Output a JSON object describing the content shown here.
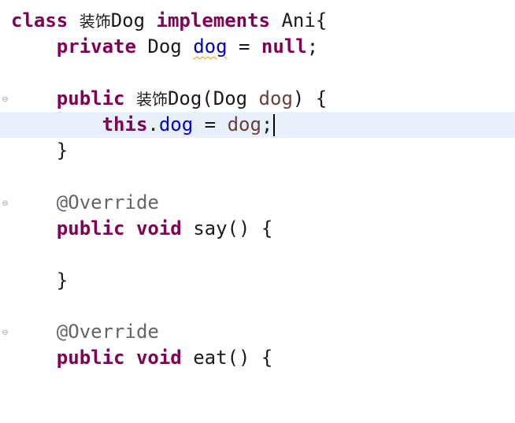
{
  "editor": {
    "fold_icon_glyph": "⊖",
    "lines": {
      "l1": {
        "kw_class": "class",
        "sp1": " ",
        "cjk_name": "装饰",
        "class_name": "Dog",
        "sp2": " ",
        "kw_implements": "implements",
        "rest": " Ani{"
      },
      "l2": {
        "indent": "    ",
        "kw_private": "private",
        "mid": " Dog ",
        "field_dog": "dog",
        "eq": " = ",
        "kw_null": "null",
        "semi": ";"
      },
      "l4": {
        "indent": "    ",
        "kw_public": "public",
        "sp": " ",
        "cjk_name": "装饰",
        "ctor_rest": "Dog(Dog ",
        "param_dog": "dog",
        "tail": ") {"
      },
      "l5": {
        "indent": "        ",
        "kw_this": "this",
        "dot": ".",
        "field_dog": "dog",
        "eq": " = ",
        "param_dog": "dog",
        "semi": ";"
      },
      "l6": {
        "indent": "    ",
        "brace": "}"
      },
      "l8": {
        "indent": "    ",
        "annotation": "@Override"
      },
      "l9": {
        "indent": "    ",
        "kw_public": "public",
        "sp1": " ",
        "kw_void": "void",
        "method": " say() {"
      },
      "l11": {
        "indent": "    ",
        "brace": "}"
      },
      "l13": {
        "indent": "    ",
        "annotation": "@Override"
      },
      "l14": {
        "indent": "    ",
        "kw_public": "public",
        "sp1": " ",
        "kw_void": "void",
        "method": " eat() {"
      }
    }
  },
  "colors": {
    "keyword": "#7f0055",
    "field": "#0000c0",
    "parameter": "#6a3e3e",
    "annotation": "#646464",
    "current_line": "#e8f0fb"
  }
}
